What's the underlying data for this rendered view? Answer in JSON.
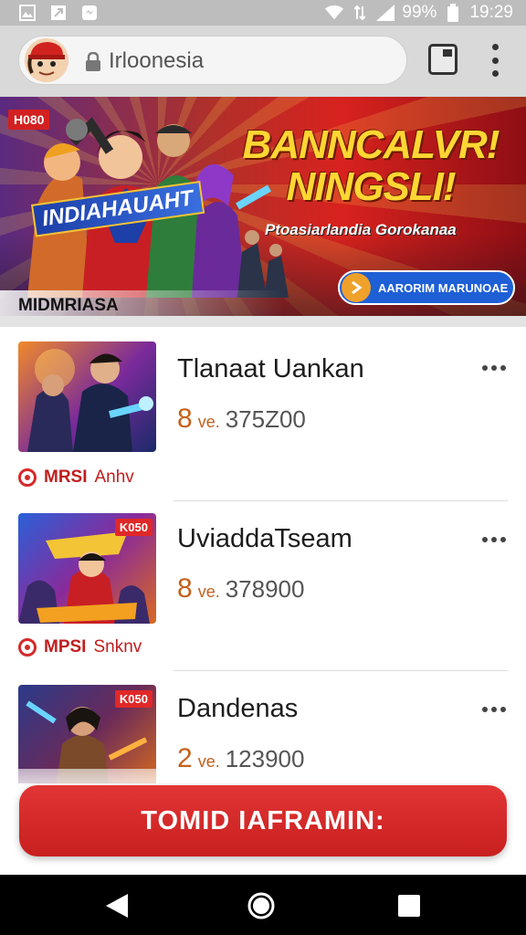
{
  "status_bar": {
    "battery_percent": "99%",
    "time": "19:29",
    "left_icons": [
      "gallery-icon",
      "navigation-icon",
      "messenger-icon"
    ],
    "right_icons": [
      "wifi-icon",
      "data-icon",
      "signal-icon",
      "battery-icon"
    ]
  },
  "browser": {
    "url": "Irloonesia",
    "icons": [
      "avatar",
      "lock-icon",
      "tabs-icon",
      "more-vert-icon"
    ]
  },
  "hero": {
    "badge": "H080",
    "logo_text": "INDIAHAUAHT",
    "headline_line1": "BANNCALVR!",
    "headline_line2": "NINGSLI!",
    "subline": "Ptoasiarlandia Gorokanaa",
    "cta_label": "AARORIM MARUNOAE",
    "caption": "MIDMRIASA"
  },
  "listings": [
    {
      "title": "Tlanaat Uankan",
      "price_currency": "8",
      "price_unit": "ve.",
      "price_value": "375Z00",
      "seller_tag": "MRSI",
      "seller_name": "Anhv",
      "badge": ""
    },
    {
      "title": "UviaddaTseam",
      "price_currency": "8",
      "price_unit": "ve.",
      "price_value": "378900",
      "seller_tag": "MPSI",
      "seller_name": "Snknv",
      "badge": "K050"
    },
    {
      "title": "Dandenas",
      "price_currency": "2",
      "price_unit": "ve.",
      "price_value": "123900",
      "seller_tag": "",
      "seller_name": "",
      "badge": "K050"
    }
  ],
  "main_cta": {
    "label": "TOMID IAFRAMIN:"
  },
  "colors": {
    "accent": "#d12a2a",
    "price": "#c4611c",
    "chrome": "#d9d9d9"
  }
}
